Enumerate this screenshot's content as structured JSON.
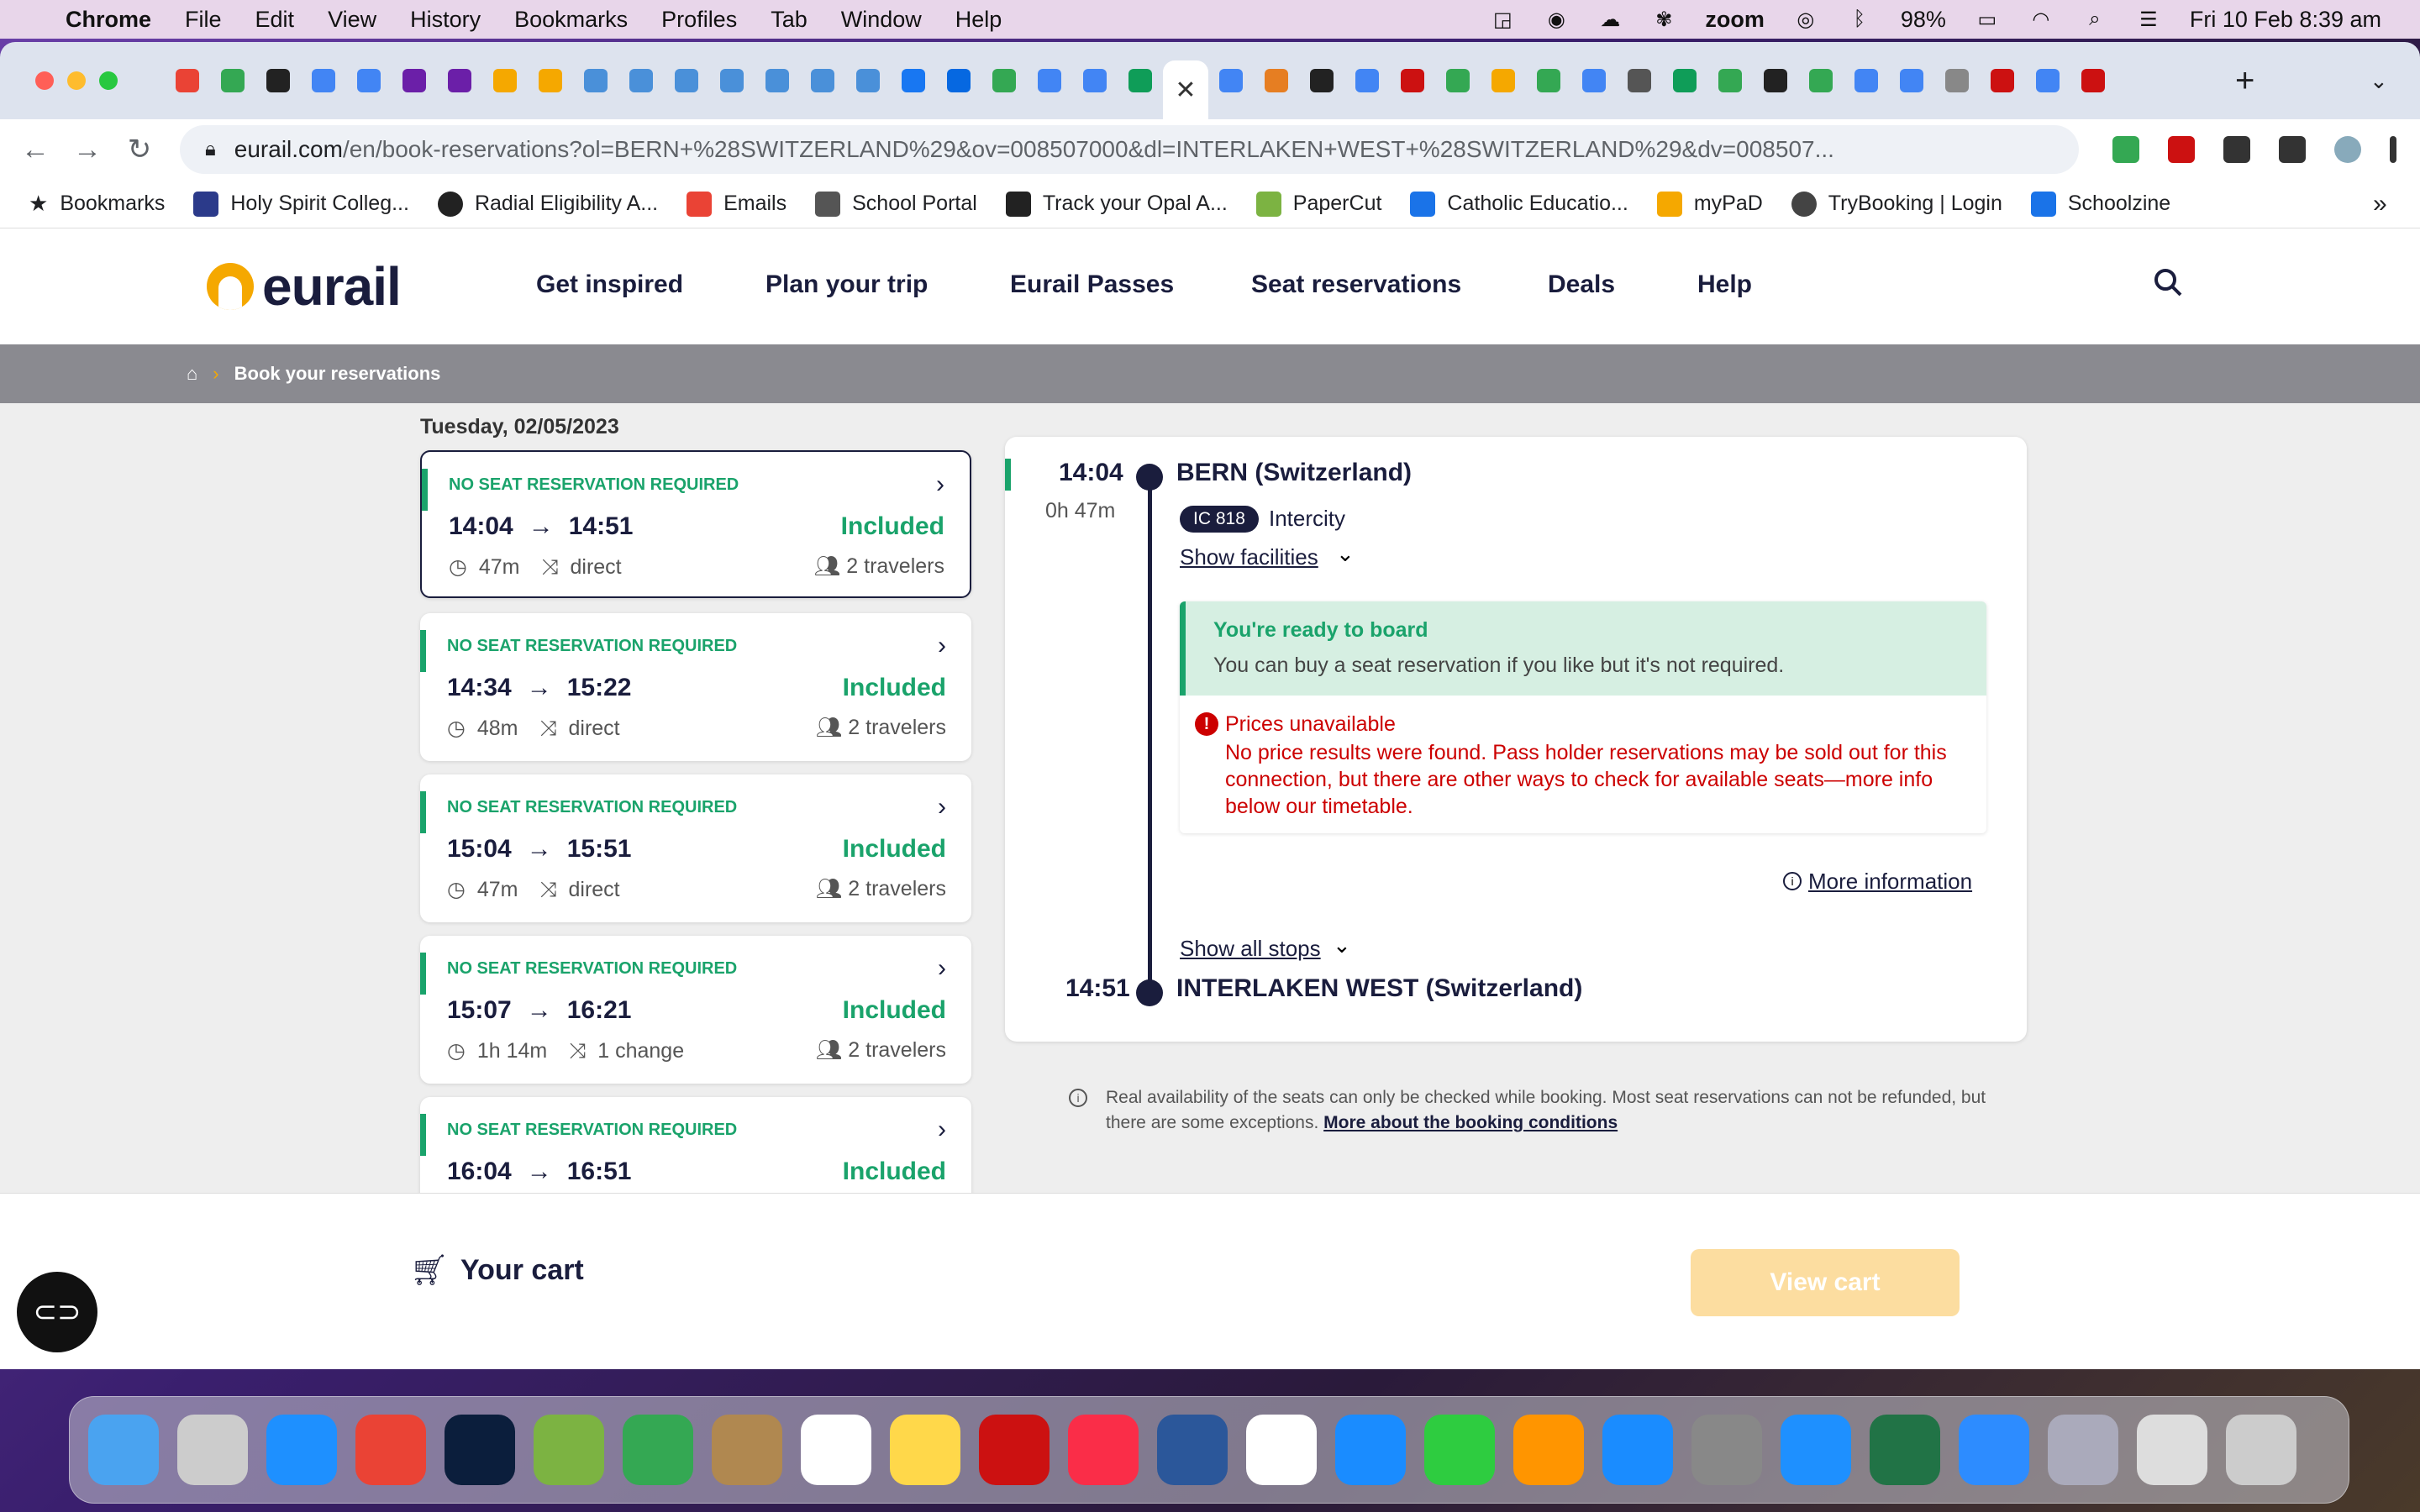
{
  "menubar": {
    "app": "Chrome",
    "items": [
      "File",
      "Edit",
      "View",
      "History",
      "Bookmarks",
      "Profiles",
      "Tab",
      "Window",
      "Help"
    ],
    "battery": "98%",
    "clock": "Fri 10 Feb  8:39 am",
    "zoom_label": "zoom"
  },
  "browser": {
    "url_domain": "eurail.com",
    "url_path": "/en/book-reservations?ol=BERN+%28SWITZERLAND%29&ov=008507000&dl=INTERLAKEN+WEST+%28SWITZERLAND%29&dv=008507...",
    "bookmarks": [
      "Bookmarks",
      "Holy Spirit Colleg...",
      "Radial Eligibility A...",
      "Emails",
      "School Portal",
      "Track your Opal A...",
      "PaperCut",
      "Catholic Educatio...",
      "myPaD",
      "TryBooking | Login",
      "Schoolzine"
    ],
    "more_bookmarks": "»"
  },
  "site": {
    "logo": "eurail",
    "nav": [
      "Get inspired",
      "Plan your trip",
      "Eurail Passes",
      "Seat reservations",
      "Deals",
      "Help"
    ],
    "breadcrumb": "Book your reservations"
  },
  "date_label": "Tuesday, 02/05/2023",
  "connections": [
    {
      "tag": "NO SEAT RESERVATION REQUIRED",
      "dep": "14:04",
      "arr": "14:51",
      "price": "Included",
      "duration": "47m",
      "changes": "direct",
      "travelers": "2 travelers"
    },
    {
      "tag": "NO SEAT RESERVATION REQUIRED",
      "dep": "14:34",
      "arr": "15:22",
      "price": "Included",
      "duration": "48m",
      "changes": "direct",
      "travelers": "2 travelers"
    },
    {
      "tag": "NO SEAT RESERVATION REQUIRED",
      "dep": "15:04",
      "arr": "15:51",
      "price": "Included",
      "duration": "47m",
      "changes": "direct",
      "travelers": "2 travelers"
    },
    {
      "tag": "NO SEAT RESERVATION REQUIRED",
      "dep": "15:07",
      "arr": "16:21",
      "price": "Included",
      "duration": "1h 14m",
      "changes": "1 change",
      "travelers": "2 travelers"
    },
    {
      "tag": "NO SEAT RESERVATION REQUIRED",
      "dep": "16:04",
      "arr": "16:51",
      "price": "Included",
      "duration": "",
      "changes": "",
      "travelers": ""
    }
  ],
  "detail": {
    "dep_time": "14:04",
    "duration": "0h 47m",
    "origin": "BERN (Switzerland)",
    "train_badge": "IC 818",
    "train_type": "Intercity",
    "show_facilities": "Show facilities",
    "ready_title": "You're ready to board",
    "ready_text": "You can buy a seat reservation if you like but it's not required.",
    "err_title": "Prices unavailable",
    "err_text": "No price results were found. Pass holder reservations may be sold out for this connection, but there are other ways to check for available seats—more info below our timetable.",
    "more_info": "More information",
    "show_stops": "Show all stops",
    "arr_time": "14:51",
    "destination": "INTERLAKEN WEST (Switzerland)"
  },
  "note": {
    "text": "Real availability of the seats can only be checked while booking. Most seat reservations can not be refunded, but there are some exceptions. ",
    "link": "More about the booking conditions"
  },
  "cart": {
    "label": "Your cart",
    "button": "View cart"
  },
  "colors": {
    "accent_green": "#1aa36b",
    "navy": "#1a1d3d",
    "brand_yellow": "#f5a800",
    "error_red": "#cc0000"
  }
}
